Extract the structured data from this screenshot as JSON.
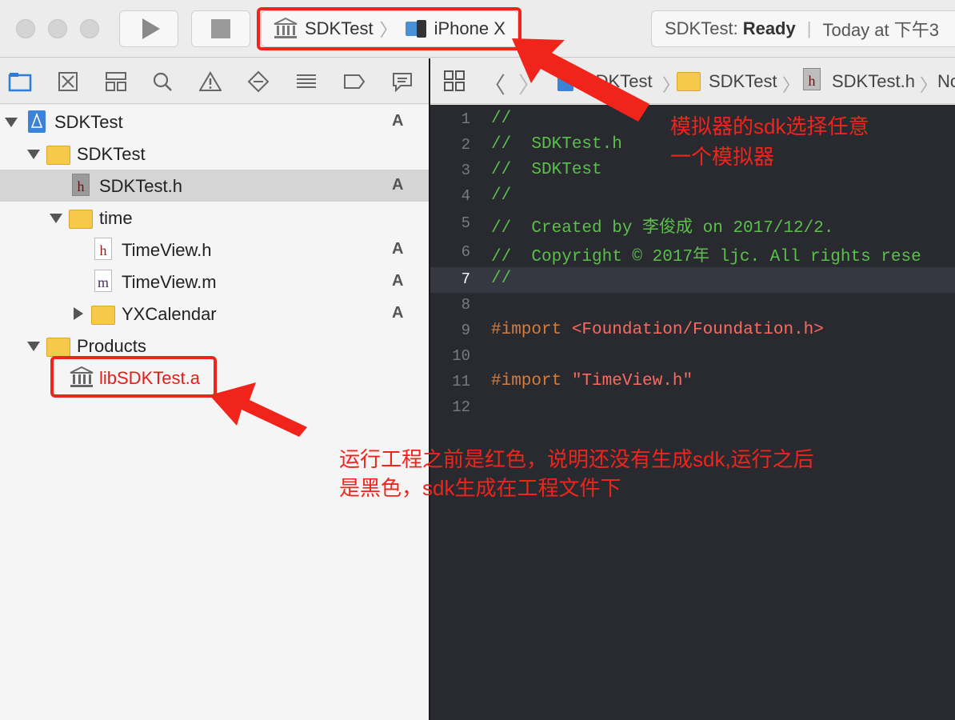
{
  "toolbar": {
    "scheme": {
      "target": "SDKTest",
      "device": "iPhone X"
    },
    "activity": {
      "project": "SDKTest:",
      "status": "Ready",
      "time": "Today at 下午3"
    }
  },
  "navigator": {
    "rows": [
      {
        "label": "SDKTest",
        "badge": "A"
      },
      {
        "label": "SDKTest",
        "badge": ""
      },
      {
        "label": "SDKTest.h",
        "badge": "A"
      },
      {
        "label": "time",
        "badge": ""
      },
      {
        "label": "TimeView.h",
        "badge": "A"
      },
      {
        "label": "TimeView.m",
        "badge": "A"
      },
      {
        "label": "YXCalendar",
        "badge": "A"
      },
      {
        "label": "Products",
        "badge": ""
      },
      {
        "label": "libSDKTest.a",
        "badge": ""
      }
    ],
    "file_letters": {
      "h": "h",
      "m": "m"
    }
  },
  "jumpbar": {
    "crumbs": [
      "SDKTest",
      "SDKTest",
      "SDKTest.h",
      "No"
    ]
  },
  "editor": {
    "lines": [
      {
        "n": "1",
        "text": "//"
      },
      {
        "n": "2",
        "text": "//  SDKTest.h"
      },
      {
        "n": "3",
        "text": "//  SDKTest"
      },
      {
        "n": "4",
        "text": "//"
      },
      {
        "n": "5",
        "text": "//  Created by 李俊成 on 2017/12/2."
      },
      {
        "n": "6",
        "text": "//  Copyright © 2017年 ljc. All rights rese"
      },
      {
        "n": "7",
        "text": "//"
      },
      {
        "n": "8",
        "text": ""
      },
      {
        "n": "9",
        "kw": "#import",
        "str": "<Foundation/Foundation.h>"
      },
      {
        "n": "10",
        "text": ""
      },
      {
        "n": "11",
        "kw": "#import",
        "str": "\"TimeView.h\""
      },
      {
        "n": "12",
        "text": ""
      }
    ],
    "current_line": "7"
  },
  "annotations": {
    "simulator_note_line1": "模拟器的sdk选择任意",
    "simulator_note_line2": "一个模拟器",
    "product_note_line1": "运行工程之前是红色，说明还没有生成sdk,运行之后",
    "product_note_line2": "是黑色，sdk生成在工程文件下"
  },
  "colors": {
    "annotation_red": "#f0241b",
    "comment_green": "#5bc04b",
    "keyword_orange": "#d67c3a",
    "string_red": "#fc6a5d",
    "editor_bg": "#292a30",
    "missing_product_red": "#e0201a"
  }
}
